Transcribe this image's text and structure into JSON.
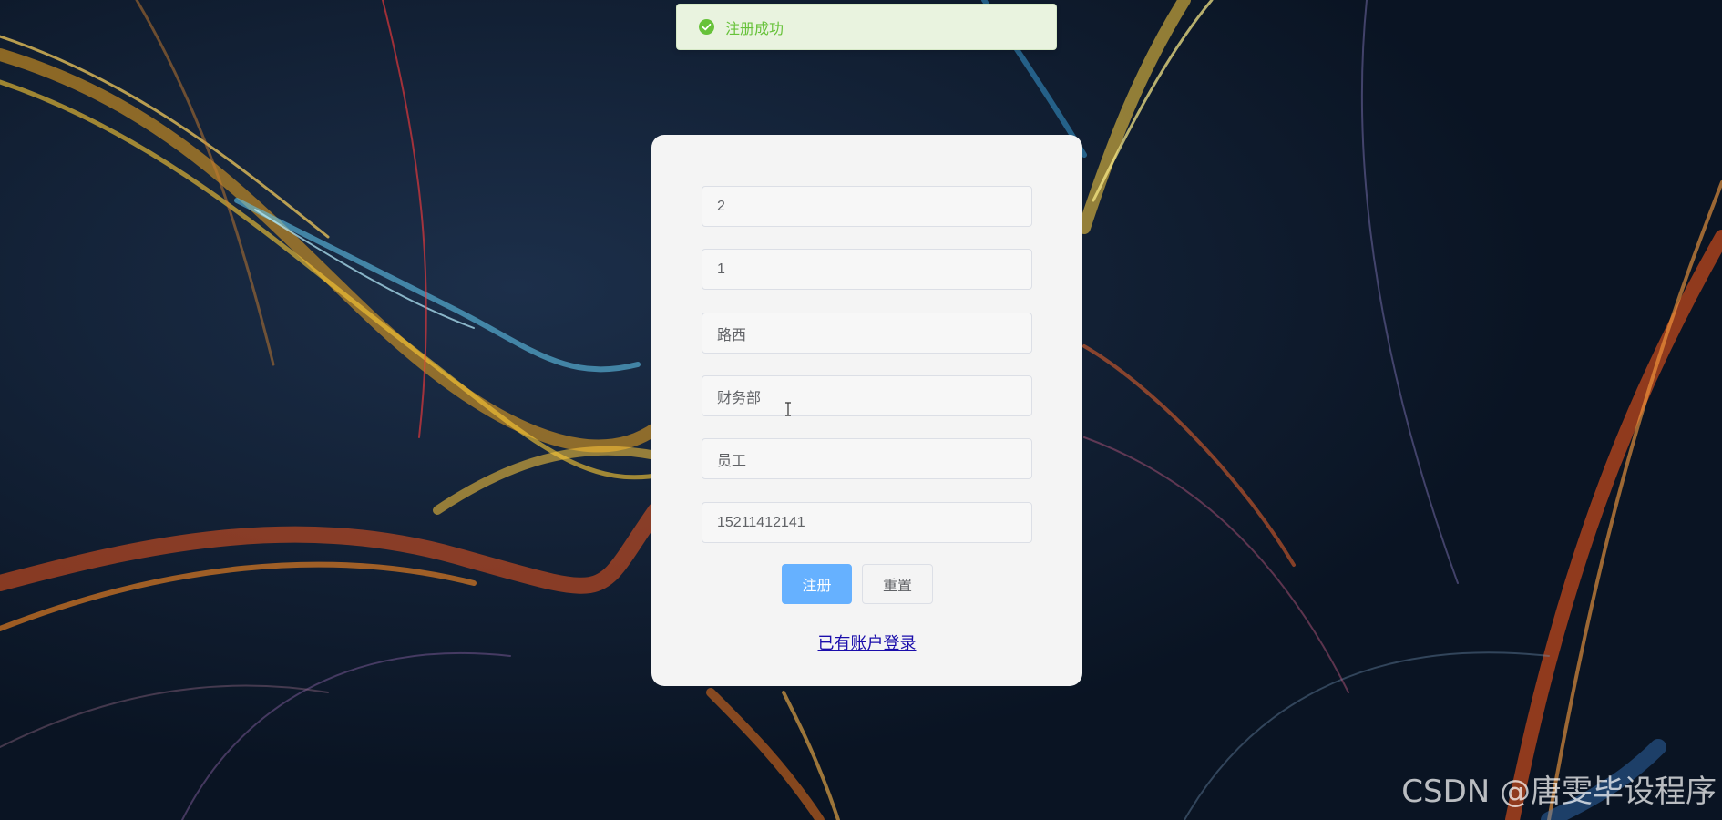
{
  "toast": {
    "icon": "check-circle-icon",
    "message": "注册成功",
    "color": "#67c23a"
  },
  "form": {
    "fields": [
      {
        "value": "2"
      },
      {
        "value": "1"
      },
      {
        "value": "路西"
      },
      {
        "value": "财务部"
      },
      {
        "value": "员工"
      },
      {
        "value": "15211412141"
      }
    ],
    "register_label": "注册",
    "reset_label": "重置",
    "login_link": "已有账户登录"
  },
  "watermark": "CSDN @唐雯毕设程序",
  "colors": {
    "primary": "#66b1ff",
    "card_bg": "#f4f4f4",
    "page_bg": "#0b1626"
  }
}
